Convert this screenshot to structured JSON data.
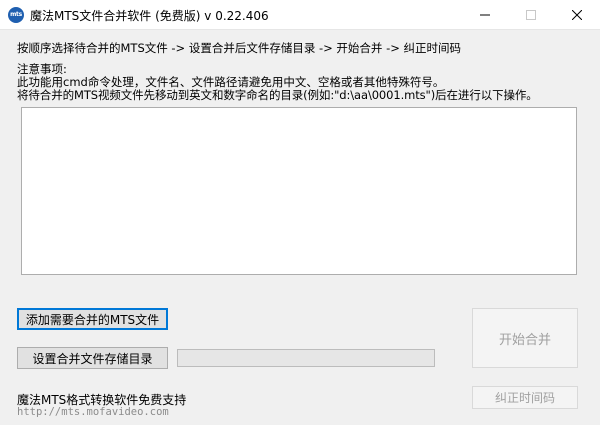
{
  "window": {
    "icon_text": "mts",
    "title": "魔法MTS文件合并软件 (免费版) v 0.22.406"
  },
  "instructions": {
    "steps": "按顺序选择待合并的MTS文件 -> 设置合并后文件存储目录  -> 开始合并 -> 纠正时间码",
    "notes_title": "注意事项:",
    "note1": "此功能用cmd命令处理，文件名、文件路径请避免用中文、空格或者其他特殊符号。",
    "note2": "将待合并的MTS视频文件先移动到英文和数字命名的目录(例如:\"d:\\aa\\0001.mts\")后在进行以下操作。"
  },
  "buttons": {
    "add_files": "添加需要合并的MTS文件",
    "set_output_dir": "设置合并文件存储目录",
    "start_merge": "开始合并",
    "fix_timecode": "纠正时间码"
  },
  "progress": {
    "value": 0
  },
  "footer": {
    "support_text": "魔法MTS格式转换软件免费支持",
    "support_link": "http://mts.mofavideo.com"
  },
  "icons": {
    "minimize": "minimize-icon",
    "maximize": "maximize-icon",
    "close": "close-icon",
    "app": "app-icon"
  },
  "colors": {
    "focus_border": "#0078d7",
    "disabled_text": "#a0a0a0",
    "app_icon": "#1f5fb0"
  }
}
